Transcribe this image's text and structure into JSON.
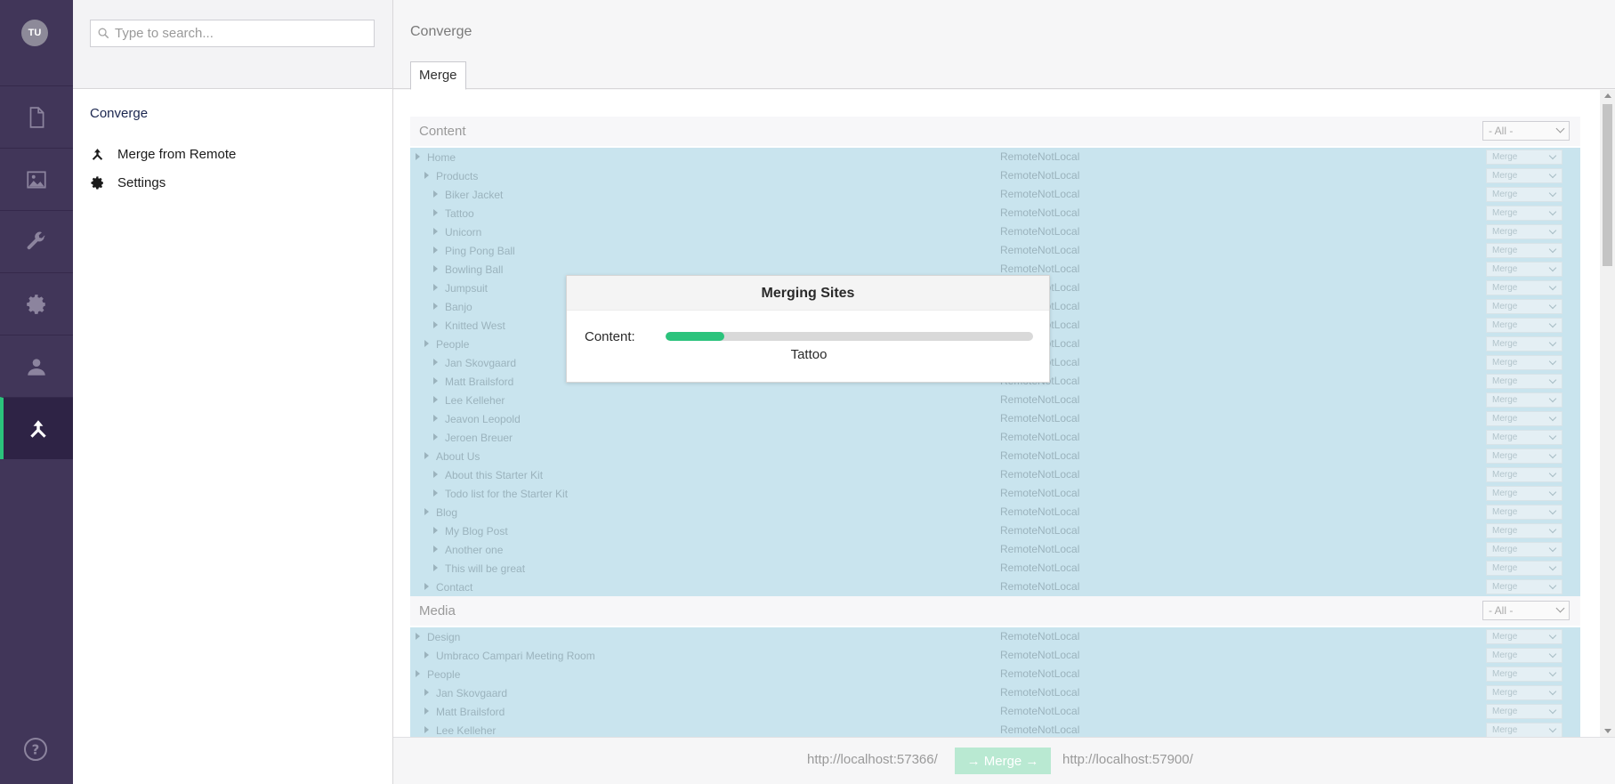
{
  "user": {
    "initials": "TU"
  },
  "rail": {
    "items": [
      {
        "name": "content",
        "icon": "document-icon"
      },
      {
        "name": "media",
        "icon": "image-icon"
      },
      {
        "name": "developer",
        "icon": "wrench-icon"
      },
      {
        "name": "settings",
        "icon": "gear-icon"
      },
      {
        "name": "users",
        "icon": "user-icon"
      },
      {
        "name": "converge",
        "icon": "merge-icon",
        "active": true
      }
    ],
    "help_icon": "help-icon"
  },
  "tree": {
    "search_placeholder": "Type to search...",
    "title": "Converge",
    "links": [
      {
        "label": "Merge from Remote",
        "icon": "merge-icon"
      },
      {
        "label": "Settings",
        "icon": "gear-icon"
      }
    ]
  },
  "editor": {
    "title": "Converge",
    "tab": "Merge",
    "content_section": {
      "label": "Content",
      "filter": "- All -",
      "rows": [
        {
          "name": "Home",
          "level": 0,
          "status": "RemoteNotLocal",
          "action": "Merge"
        },
        {
          "name": "Products",
          "level": 1,
          "status": "RemoteNotLocal",
          "action": "Merge"
        },
        {
          "name": "Biker Jacket",
          "level": 2,
          "status": "RemoteNotLocal",
          "action": "Merge"
        },
        {
          "name": "Tattoo",
          "level": 2,
          "status": "RemoteNotLocal",
          "action": "Merge"
        },
        {
          "name": "Unicorn",
          "level": 2,
          "status": "RemoteNotLocal",
          "action": "Merge"
        },
        {
          "name": "Ping Pong Ball",
          "level": 2,
          "status": "RemoteNotLocal",
          "action": "Merge"
        },
        {
          "name": "Bowling Ball",
          "level": 2,
          "status": "RemoteNotLocal",
          "action": "Merge"
        },
        {
          "name": "Jumpsuit",
          "level": 2,
          "status": "RemoteNotLocal",
          "action": "Merge"
        },
        {
          "name": "Banjo",
          "level": 2,
          "status": "RemoteNotLocal",
          "action": "Merge"
        },
        {
          "name": "Knitted West",
          "level": 2,
          "status": "RemoteNotLocal",
          "action": "Merge"
        },
        {
          "name": "People",
          "level": 1,
          "status": "RemoteNotLocal",
          "action": "Merge"
        },
        {
          "name": "Jan Skovgaard",
          "level": 2,
          "status": "RemoteNotLocal",
          "action": "Merge"
        },
        {
          "name": "Matt Brailsford",
          "level": 2,
          "status": "RemoteNotLocal",
          "action": "Merge"
        },
        {
          "name": "Lee Kelleher",
          "level": 2,
          "status": "RemoteNotLocal",
          "action": "Merge"
        },
        {
          "name": "Jeavon Leopold",
          "level": 2,
          "status": "RemoteNotLocal",
          "action": "Merge"
        },
        {
          "name": "Jeroen Breuer",
          "level": 2,
          "status": "RemoteNotLocal",
          "action": "Merge"
        },
        {
          "name": "About Us",
          "level": 1,
          "status": "RemoteNotLocal",
          "action": "Merge"
        },
        {
          "name": "About this Starter Kit",
          "level": 2,
          "status": "RemoteNotLocal",
          "action": "Merge"
        },
        {
          "name": "Todo list for the Starter Kit",
          "level": 2,
          "status": "RemoteNotLocal",
          "action": "Merge"
        },
        {
          "name": "Blog",
          "level": 1,
          "status": "RemoteNotLocal",
          "action": "Merge"
        },
        {
          "name": "My Blog Post",
          "level": 2,
          "status": "RemoteNotLocal",
          "action": "Merge"
        },
        {
          "name": "Another one",
          "level": 2,
          "status": "RemoteNotLocal",
          "action": "Merge"
        },
        {
          "name": "This will be great",
          "level": 2,
          "status": "RemoteNotLocal",
          "action": "Merge"
        },
        {
          "name": "Contact",
          "level": 1,
          "status": "RemoteNotLocal",
          "action": "Merge"
        }
      ]
    },
    "media_section": {
      "label": "Media",
      "filter": "- All -",
      "rows": [
        {
          "name": "Design",
          "level": 0,
          "status": "RemoteNotLocal",
          "action": "Merge"
        },
        {
          "name": "Umbraco Campari Meeting Room",
          "level": 1,
          "status": "RemoteNotLocal",
          "action": "Merge"
        },
        {
          "name": "People",
          "level": 0,
          "status": "RemoteNotLocal",
          "action": "Merge"
        },
        {
          "name": "Jan Skovgaard",
          "level": 1,
          "status": "RemoteNotLocal",
          "action": "Merge"
        },
        {
          "name": "Matt Brailsford",
          "level": 1,
          "status": "RemoteNotLocal",
          "action": "Merge"
        },
        {
          "name": "Lee Kelleher",
          "level": 1,
          "status": "RemoteNotLocal",
          "action": "Merge"
        }
      ]
    },
    "footer": {
      "source_url": "http://localhost:57366/",
      "merge_button": "→ Merge →",
      "target_url": "http://localhost:57900/"
    }
  },
  "modal": {
    "title": "Merging Sites",
    "label": "Content:",
    "progress_percent": 16,
    "current_item": "Tattoo"
  },
  "colors": {
    "rail_bg": "#413659",
    "accent": "#2bc37c",
    "row_bg": "#c9e4ee"
  }
}
